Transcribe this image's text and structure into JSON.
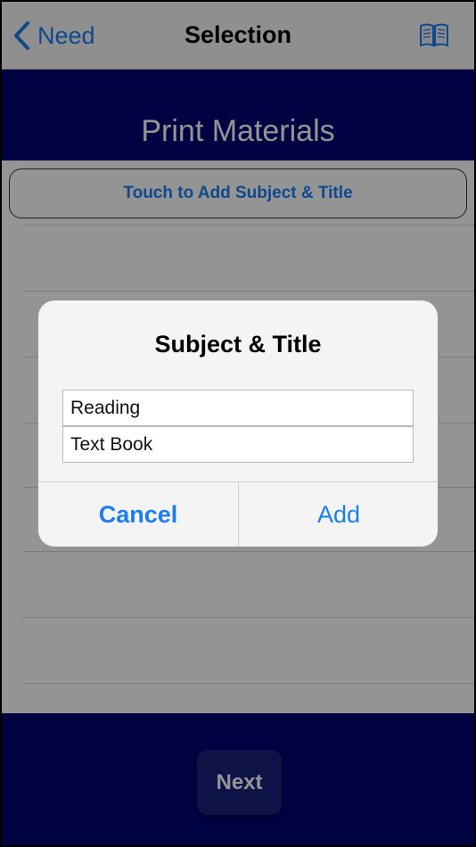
{
  "nav": {
    "back_label": "Need",
    "title": "Selection",
    "right_icon": "book-icon"
  },
  "header": {
    "title": "Print Materials"
  },
  "content": {
    "add_button_label": "Touch to Add Subject & Title"
  },
  "footer": {
    "next_label": "Next"
  },
  "alert": {
    "title": "Subject & Title",
    "fields": [
      {
        "value": "Reading"
      },
      {
        "value": "Text Book"
      }
    ],
    "cancel_label": "Cancel",
    "add_label": "Add"
  },
  "colors": {
    "accent": "#1a7ef2",
    "brand_navy": "#030473"
  }
}
